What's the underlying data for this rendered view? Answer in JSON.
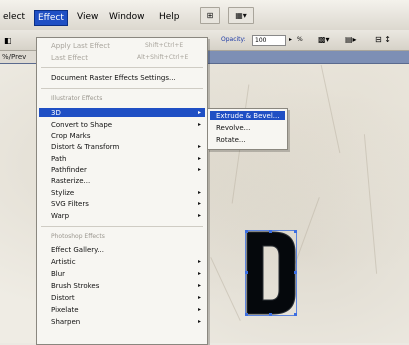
{
  "menubar": {
    "items": [
      "elect",
      "Effect",
      "View",
      "Window",
      "Help"
    ],
    "active": "Effect"
  },
  "controlbar": {
    "opacity_label": "Opacity:",
    "opacity_value": "100",
    "percent": "%",
    "tab_label": "%/Prev"
  },
  "effect_menu": {
    "apply_last": "Apply Last Effect",
    "apply_last_shortcut": "Shift+Ctrl+E",
    "last_effect": "Last Effect",
    "last_effect_shortcut": "Alt+Shift+Ctrl+E",
    "document_raster": "Document Raster Effects Settings...",
    "illustrator_header": "Illustrator Effects",
    "illustrator_items": [
      "3D",
      "Convert to Shape",
      "Crop Marks",
      "Distort & Transform",
      "Path",
      "Pathfinder",
      "Rasterize...",
      "Stylize",
      "SVG Filters",
      "Warp"
    ],
    "photoshop_header": "Photoshop Effects",
    "photoshop_items": [
      "Effect Gallery...",
      "Artistic",
      "Blur",
      "Brush Strokes",
      "Distort",
      "Pixelate",
      "Sharpen"
    ]
  },
  "submenu_3d": {
    "items": [
      "Extrude & Bevel...",
      "Revolve...",
      "Rotate..."
    ]
  },
  "artwork": {
    "letter": "D"
  },
  "colors": {
    "highlight": "#1f4fc4",
    "menu_bg": "#f7f6f2",
    "canvas": "#efece4"
  }
}
